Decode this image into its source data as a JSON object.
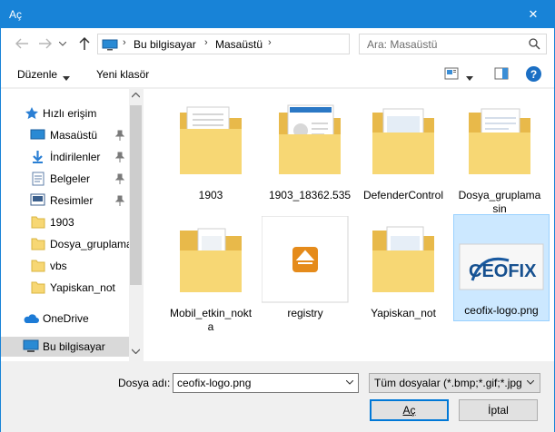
{
  "window": {
    "title": "Aç",
    "close_glyph": "✕"
  },
  "address": {
    "crumbs": [
      "Bu bilgisayar",
      "Masaüstü"
    ],
    "search_placeholder": "Ara: Masaüstü"
  },
  "toolbar": {
    "organize": "Düzenle",
    "new_folder": "Yeni klasör",
    "help": "?"
  },
  "sidebar": {
    "items": [
      {
        "label": "Hızlı erişim",
        "icon": "star-icon"
      },
      {
        "label": "Masaüstü",
        "icon": "desktop-icon",
        "pinned": true
      },
      {
        "label": "İndirilenler",
        "icon": "download-icon",
        "pinned": true
      },
      {
        "label": "Belgeler",
        "icon": "documents-icon",
        "pinned": true
      },
      {
        "label": "Resimler",
        "icon": "pictures-icon",
        "pinned": true
      },
      {
        "label": "1903",
        "icon": "folder-icon"
      },
      {
        "label": "Dosya_gruplama",
        "icon": "folder-icon"
      },
      {
        "label": "vbs",
        "icon": "folder-icon"
      },
      {
        "label": "Yapiskan_not",
        "icon": "folder-icon"
      },
      {
        "label": "OneDrive",
        "icon": "cloud-icon"
      },
      {
        "label": "Bu bilgisayar",
        "icon": "computer-icon",
        "selected": true
      }
    ]
  },
  "files": [
    {
      "name": "1903",
      "type": "folder"
    },
    {
      "name": "1903_18362.535",
      "type": "folder"
    },
    {
      "name": "DefenderControl",
      "type": "folder"
    },
    {
      "name": "Dosya_gruplama",
      "name2": "sin",
      "type": "folder"
    },
    {
      "name": "Mobil_etkin_nokt",
      "name2": "a",
      "type": "folder"
    },
    {
      "name": "registry",
      "type": "registry"
    },
    {
      "name": "Yapiskan_not",
      "type": "folder"
    },
    {
      "name": "ceofix-logo.png",
      "type": "image",
      "selected": true,
      "logo_text": "CEOFIX"
    }
  ],
  "footer": {
    "filename_label": "Dosya adı:",
    "filename_value": "ceofix-logo.png",
    "filetype_value": "Tüm dosyalar (*.bmp;*.gif;*.jpg",
    "open_label": "Aç",
    "cancel_label": "İptal"
  },
  "colors": {
    "accent": "#1883d7",
    "selected_bg": "#cce8ff",
    "folder": "#f7d774"
  }
}
